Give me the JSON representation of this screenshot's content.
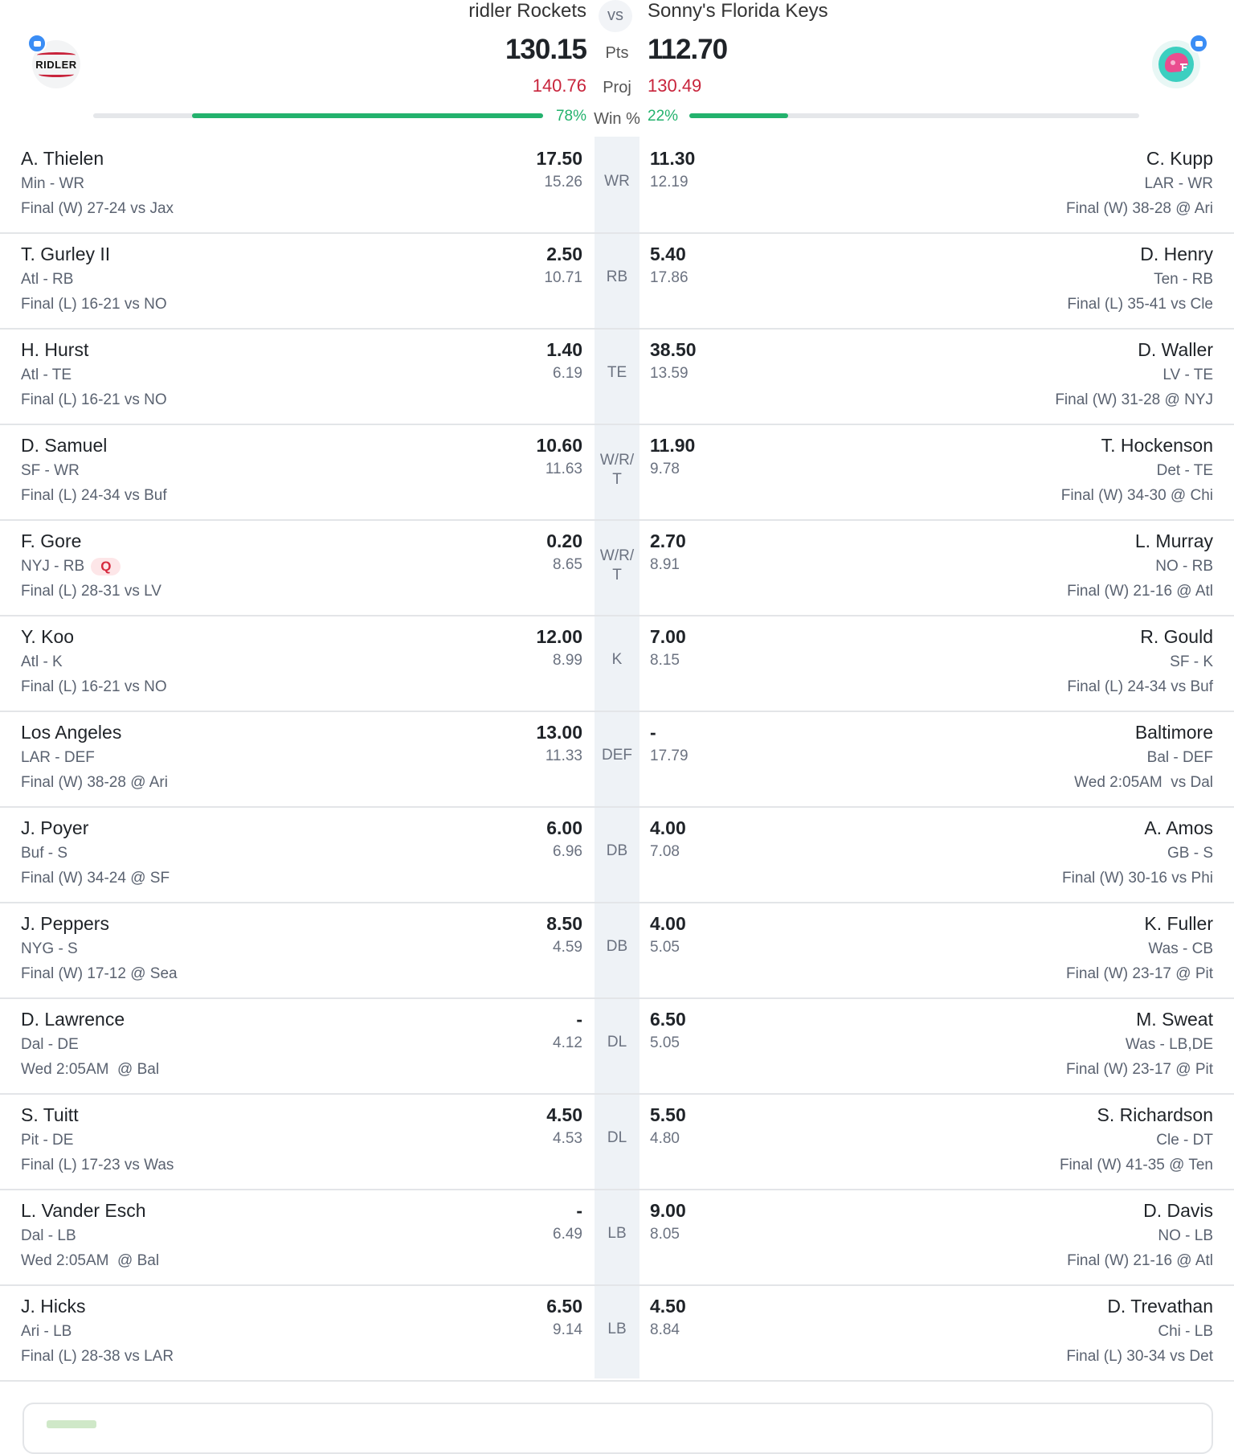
{
  "matchup": {
    "left_team": "ridler Rockets",
    "right_team": "Sonny's Florida Keys",
    "vs": "vs",
    "pts_label": "Pts",
    "proj_label": "Proj",
    "win_label": "Win %",
    "left_pts": "130.15",
    "right_pts": "112.70",
    "left_proj": "140.76",
    "right_proj": "130.49",
    "left_win": "78%",
    "right_win": "22%",
    "left_win_value": 0.78,
    "right_win_value": 0.22,
    "left_logo_text": "RIDLER"
  },
  "colors": {
    "win_green": "#23b26d",
    "proj_red": "#c8243c",
    "injury_badge": "#d62a3e"
  },
  "rows": [
    {
      "pos": "WR",
      "l": {
        "name": "A. Thielen",
        "team": "Min - WR",
        "game": "Final (W) 27-24 vs Jax",
        "pts": "17.50",
        "proj": "15.26"
      },
      "r": {
        "name": "C. Kupp",
        "team": "LAR - WR",
        "game": "Final (W) 38-28 @ Ari",
        "pts": "11.30",
        "proj": "12.19"
      }
    },
    {
      "pos": "RB",
      "l": {
        "name": "T. Gurley II",
        "team": "Atl - RB",
        "game": "Final (L) 16-21 vs NO",
        "pts": "2.50",
        "proj": "10.71"
      },
      "r": {
        "name": "D. Henry",
        "team": "Ten - RB",
        "game": "Final (L) 35-41 vs Cle",
        "pts": "5.40",
        "proj": "17.86"
      }
    },
    {
      "pos": "TE",
      "l": {
        "name": "H. Hurst",
        "team": "Atl - TE",
        "game": "Final (L) 16-21 vs NO",
        "pts": "1.40",
        "proj": "6.19"
      },
      "r": {
        "name": "D. Waller",
        "team": "LV - TE",
        "game": "Final (W) 31-28 @ NYJ",
        "pts": "38.50",
        "proj": "13.59"
      }
    },
    {
      "pos": "W/R/T",
      "l": {
        "name": "D. Samuel",
        "team": "SF - WR",
        "game": "Final (L) 24-34 vs Buf",
        "pts": "10.60",
        "proj": "11.63"
      },
      "r": {
        "name": "T. Hockenson",
        "team": "Det - TE",
        "game": "Final (W) 34-30 @ Chi",
        "pts": "11.90",
        "proj": "9.78"
      }
    },
    {
      "pos": "W/R/T",
      "l": {
        "name": "F. Gore",
        "team": "NYJ - RB",
        "injury": "Q",
        "game": "Final (L) 28-31 vs LV",
        "pts": "0.20",
        "proj": "8.65"
      },
      "r": {
        "name": "L. Murray",
        "team": "NO - RB",
        "game": "Final (W) 21-16 @ Atl",
        "pts": "2.70",
        "proj": "8.91"
      }
    },
    {
      "pos": "K",
      "l": {
        "name": "Y. Koo",
        "team": "Atl - K",
        "game": "Final (L) 16-21 vs NO",
        "pts": "12.00",
        "proj": "8.99"
      },
      "r": {
        "name": "R. Gould",
        "team": "SF - K",
        "game": "Final (L) 24-34 vs Buf",
        "pts": "7.00",
        "proj": "8.15"
      }
    },
    {
      "pos": "DEF",
      "l": {
        "name": "Los Angeles",
        "team": "LAR - DEF",
        "game": "Final (W) 38-28 @ Ari",
        "pts": "13.00",
        "proj": "11.33"
      },
      "r": {
        "name": "Baltimore",
        "team": "Bal - DEF",
        "game": "Wed 2:05AM  vs Dal",
        "pts": "-",
        "proj": "17.79"
      }
    },
    {
      "pos": "DB",
      "l": {
        "name": "J. Poyer",
        "team": "Buf - S",
        "game": "Final (W) 34-24 @ SF",
        "pts": "6.00",
        "proj": "6.96"
      },
      "r": {
        "name": "A. Amos",
        "team": "GB - S",
        "game": "Final (W) 30-16 vs Phi",
        "pts": "4.00",
        "proj": "7.08"
      }
    },
    {
      "pos": "DB",
      "l": {
        "name": "J. Peppers",
        "team": "NYG - S",
        "game": "Final (W) 17-12 @ Sea",
        "pts": "8.50",
        "proj": "4.59"
      },
      "r": {
        "name": "K. Fuller",
        "team": "Was - CB",
        "game": "Final (W) 23-17 @ Pit",
        "pts": "4.00",
        "proj": "5.05"
      }
    },
    {
      "pos": "DL",
      "l": {
        "name": "D. Lawrence",
        "team": "Dal - DE",
        "game": "Wed 2:05AM  @ Bal",
        "pts": "-",
        "proj": "4.12"
      },
      "r": {
        "name": "M. Sweat",
        "team": "Was - LB,DE",
        "game": "Final (W) 23-17 @ Pit",
        "pts": "6.50",
        "proj": "5.05"
      }
    },
    {
      "pos": "DL",
      "l": {
        "name": "S. Tuitt",
        "team": "Pit - DE",
        "game": "Final (L) 17-23 vs Was",
        "pts": "4.50",
        "proj": "4.53"
      },
      "r": {
        "name": "S. Richardson",
        "team": "Cle - DT",
        "game": "Final (W) 41-35 @ Ten",
        "pts": "5.50",
        "proj": "4.80"
      }
    },
    {
      "pos": "LB",
      "l": {
        "name": "L. Vander Esch",
        "team": "Dal - LB",
        "game": "Wed 2:05AM  @ Bal",
        "pts": "-",
        "proj": "6.49"
      },
      "r": {
        "name": "D. Davis",
        "team": "NO - LB",
        "game": "Final (W) 21-16 @ Atl",
        "pts": "9.00",
        "proj": "8.05"
      }
    },
    {
      "pos": "LB",
      "l": {
        "name": "J. Hicks",
        "team": "Ari - LB",
        "game": "Final (L) 28-38 vs LAR",
        "pts": "6.50",
        "proj": "9.14"
      },
      "r": {
        "name": "D. Trevathan",
        "team": "Chi - LB",
        "game": "Final (L) 30-34 vs Det",
        "pts": "4.50",
        "proj": "8.84"
      }
    }
  ]
}
